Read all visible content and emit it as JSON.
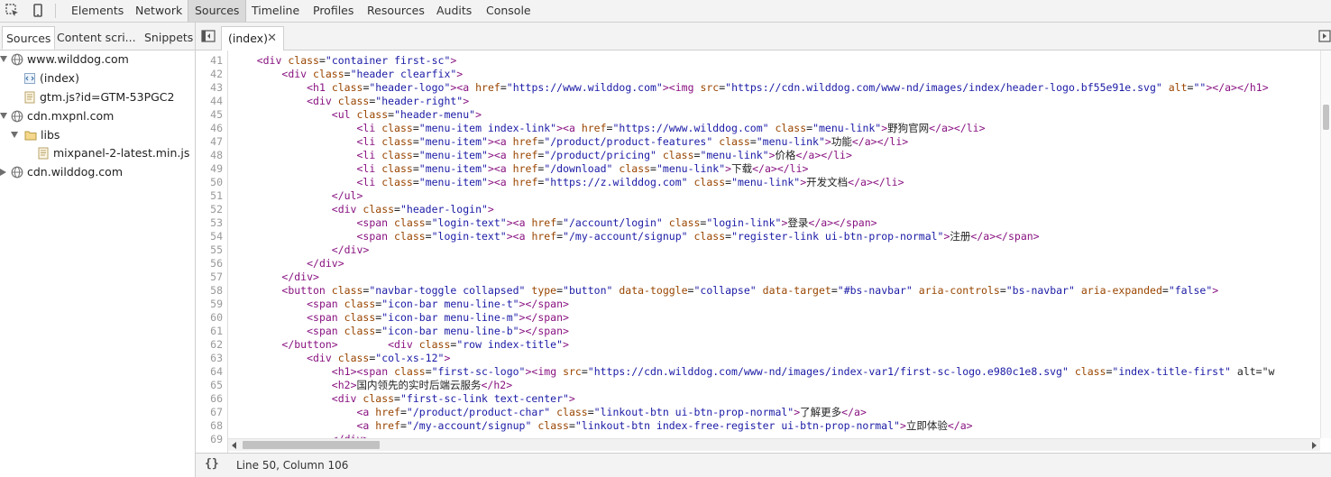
{
  "toolbar": {
    "tabs": [
      "Elements",
      "Network",
      "Sources",
      "Timeline",
      "Profiles",
      "Resources",
      "Audits",
      "Console"
    ],
    "active_tab": "Sources",
    "inspect_icon": "inspect-element-icon",
    "device_icon": "device-mode-icon"
  },
  "sidebar": {
    "tabs": [
      "Sources",
      "Content scri...",
      "Snippets"
    ],
    "active_tab": "Sources",
    "tree": [
      {
        "label": "www.wilddog.com",
        "icon": "globe-icon",
        "expanded": true,
        "depth": 0
      },
      {
        "label": "(index)",
        "icon": "html-file-icon",
        "depth": 1
      },
      {
        "label": "gtm.js?id=GTM-53PGC2",
        "icon": "script-file-icon",
        "depth": 1
      },
      {
        "label": "cdn.mxpnl.com",
        "icon": "globe-icon",
        "expanded": true,
        "depth": 0
      },
      {
        "label": "libs",
        "icon": "folder-icon",
        "expanded": true,
        "depth": 1
      },
      {
        "label": "mixpanel-2-latest.min.js",
        "icon": "script-file-icon",
        "depth": 2
      },
      {
        "label": "cdn.wilddog.com",
        "icon": "globe-icon",
        "expanded": false,
        "depth": 0
      }
    ]
  },
  "editor": {
    "file_tab": "(index)",
    "close_icon": "close-icon",
    "lines": [
      {
        "n": 41,
        "code": "    <div class=\"container first-sc\">"
      },
      {
        "n": 42,
        "code": "        <div class=\"header clearfix\">"
      },
      {
        "n": 43,
        "code": "            <h1 class=\"header-logo\"><a href=\"https://www.wilddog.com\"><img src=\"https://cdn.wilddog.com/www-nd/images/index/header-logo.bf55e91e.svg\" alt=\"\"></a></h1>"
      },
      {
        "n": 44,
        "code": "            <div class=\"header-right\">"
      },
      {
        "n": 45,
        "code": "                <ul class=\"header-menu\">"
      },
      {
        "n": 46,
        "code": "                    <li class=\"menu-item index-link\"><a href=\"https://www.wilddog.com\" class=\"menu-link\">野狗官网</a></li>"
      },
      {
        "n": 47,
        "code": "                    <li class=\"menu-item\"><a href=\"/product/product-features\" class=\"menu-link\">功能</a></li>"
      },
      {
        "n": 48,
        "code": "                    <li class=\"menu-item\"><a href=\"/product/pricing\" class=\"menu-link\">价格</a></li>"
      },
      {
        "n": 49,
        "code": "                    <li class=\"menu-item\"><a href=\"/download\" class=\"menu-link\">下载</a></li>"
      },
      {
        "n": 50,
        "code": "                    <li class=\"menu-item\"><a href=\"https://z.wilddog.com\" class=\"menu-link\">开发文档</a></li>"
      },
      {
        "n": 51,
        "code": "                </ul>"
      },
      {
        "n": 52,
        "code": "                <div class=\"header-login\">"
      },
      {
        "n": 53,
        "code": "                    <span class=\"login-text\"><a href=\"/account/login\" class=\"login-link\">登录</a></span>"
      },
      {
        "n": 54,
        "code": "                    <span class=\"login-text\"><a href=\"/my-account/signup\" class=\"register-link ui-btn-prop-normal\">注册</a></span>"
      },
      {
        "n": 55,
        "code": "                </div>"
      },
      {
        "n": 56,
        "code": "            </div>"
      },
      {
        "n": 57,
        "code": "        </div>"
      },
      {
        "n": 58,
        "code": "        <button class=\"navbar-toggle collapsed\" type=\"button\" data-toggle=\"collapse\" data-target=\"#bs-navbar\" aria-controls=\"bs-navbar\" aria-expanded=\"false\">"
      },
      {
        "n": 59,
        "code": "            <span class=\"icon-bar menu-line-t\"></span>"
      },
      {
        "n": 60,
        "code": "            <span class=\"icon-bar menu-line-m\"></span>"
      },
      {
        "n": 61,
        "code": "            <span class=\"icon-bar menu-line-b\"></span>"
      },
      {
        "n": 62,
        "code": "        </button>        <div class=\"row index-title\">"
      },
      {
        "n": 63,
        "code": "            <div class=\"col-xs-12\">"
      },
      {
        "n": 64,
        "code": "                <h1><span class=\"first-sc-logo\"><img src=\"https://cdn.wilddog.com/www-nd/images/index-var1/first-sc-logo.e980c1e8.svg\" class=\"index-title-first\" alt=\"w"
      },
      {
        "n": 65,
        "code": "                <h2>国内领先的实时后端云服务</h2>"
      },
      {
        "n": 66,
        "code": "                <div class=\"first-sc-link text-center\">"
      },
      {
        "n": 67,
        "code": "                    <a href=\"/product/product-char\" class=\"linkout-btn ui-btn-prop-normal\">了解更多</a>"
      },
      {
        "n": 68,
        "code": "                    <a href=\"/my-account/signup\" class=\"linkout-btn index-free-register ui-btn-prop-normal\">立即体验</a>"
      },
      {
        "n": 69,
        "code": "                </div>"
      }
    ]
  },
  "status": {
    "pretty_print": "{}",
    "position": "Line 50, Column 106"
  }
}
